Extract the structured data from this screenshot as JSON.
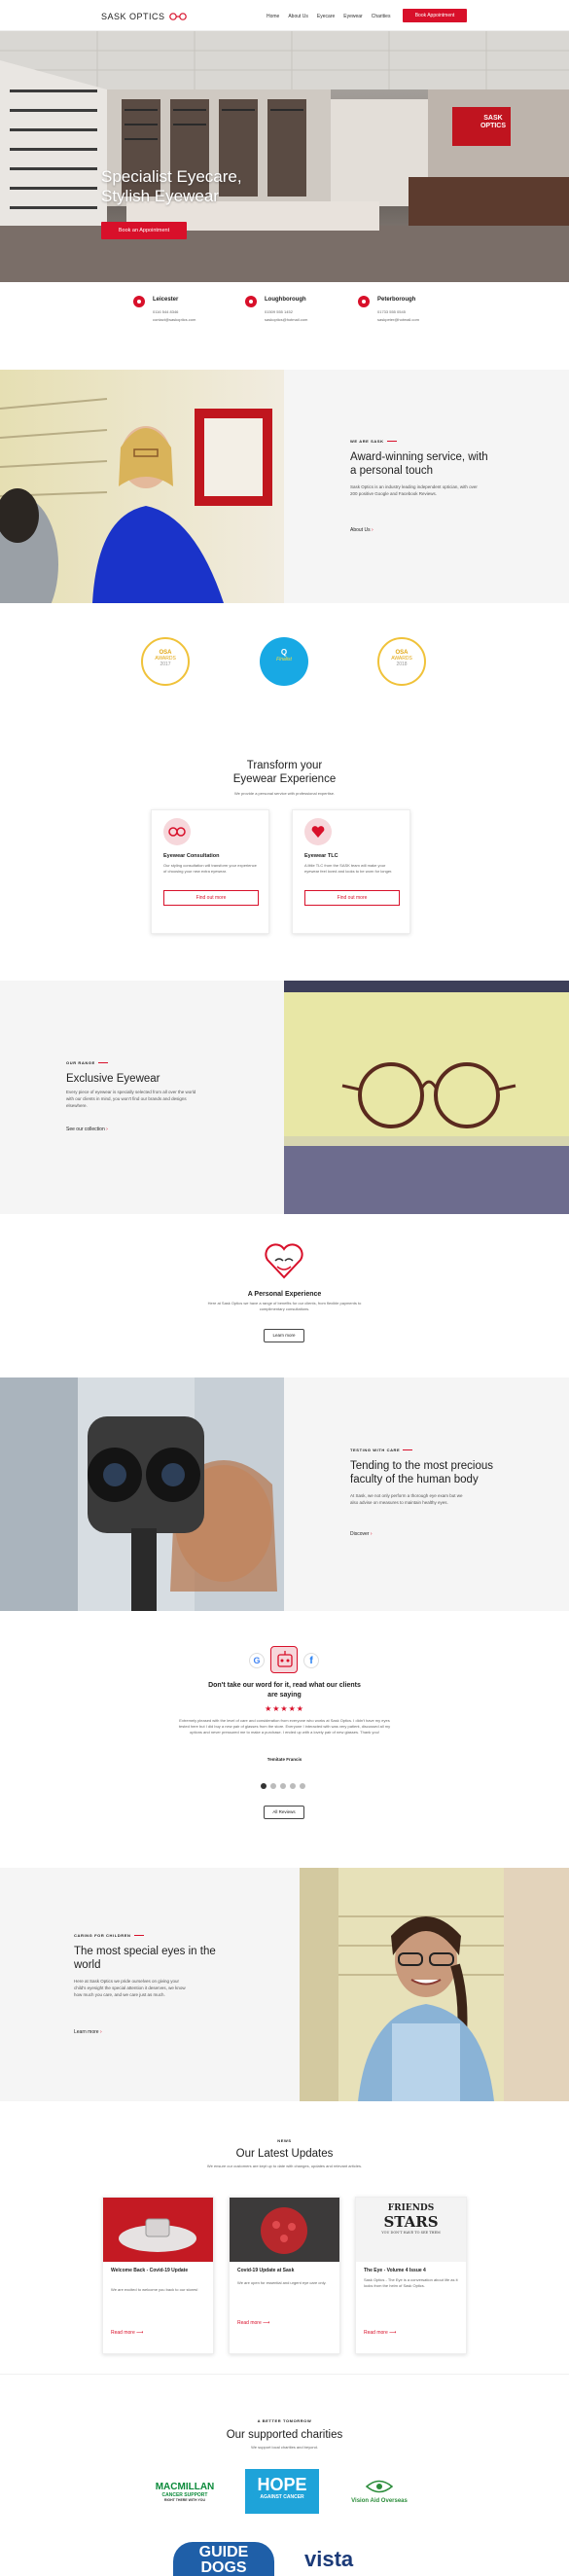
{
  "header": {
    "logo_text": "SASK OPTICS",
    "nav": [
      "Home",
      "About Us",
      "Eyecare",
      "Eyewear",
      "Charities"
    ],
    "cta": "Book Appointment"
  },
  "hero": {
    "title_line1": "Specialist Eyecare,",
    "title_line2": "Stylish Eyewear",
    "cta": "Book an Appointment",
    "sign_line1": "SASK",
    "sign_line2": "OPTICS"
  },
  "locations": [
    {
      "name": "Leicester",
      "phone": "0116 544 8346",
      "email": "contact@saskoptics.com"
    },
    {
      "name": "Loughborough",
      "phone": "01509 555 1452",
      "email": "saskoptics@hotmail.com"
    },
    {
      "name": "Peterborough",
      "phone": "01733 555 0545",
      "email": "saskpeter@hotmail.com"
    }
  ],
  "about": {
    "kicker": "WE ARE SASK",
    "title": "Award-winning service, with a personal touch",
    "body": "Sask Optics is an industry leading independent optician, with over 200 positive Google and Facebook Reviews.",
    "link": "About Us"
  },
  "awards": [
    {
      "line1": "OSA",
      "line2": "AWARDS",
      "line3": "2017"
    },
    {
      "line1": "Q",
      "line2": "Finalist",
      "line3": ""
    },
    {
      "line1": "OSA",
      "line2": "AWARDS",
      "line3": "2018"
    }
  ],
  "transform": {
    "title_line1": "Transform your",
    "title_line2": "Eyewear Experience",
    "subtitle": "We provide a personal service with professional expertise.",
    "cards": [
      {
        "title": "Eyewear Consultation",
        "body": "Our styling consultation will transform your experience of choosing your new extra eyewear.",
        "button": "Find out more"
      },
      {
        "title": "Eyewear TLC",
        "body": "A little TLC from the SASK team will make your eyewear feel loved and looks to be worn for longer.",
        "button": "Find out more"
      }
    ]
  },
  "range": {
    "kicker": "OUR RANGE",
    "title": "Exclusive Eyewear",
    "body": "Every piece of eyewear is specially selected from all over the world with our clients in mind, you won't find our brands and designs elsewhere.",
    "link": "See our collection"
  },
  "personal": {
    "title": "A Personal Experience",
    "body": "Here at Sask Optics we have a range of benefits for our clients, from flexible payments to complimentary consultations.",
    "button": "Learn more"
  },
  "testing": {
    "kicker": "TESTING WITH CARE",
    "title": "Tending to the most precious faculty of the human body",
    "body": "At Sask, we not only perform a thorough eye exam but we also advise on measures to maintain healthy eyes.",
    "link": "Discover"
  },
  "reviews": {
    "title_line1": "Don't take our word for it, read what our clients",
    "title_line2": "are saying",
    "stars": "★★★★★",
    "quote": "Extremely pleased with the level of care and consideration from everyone who works at Sask Optics. I didn't have my eyes tested here but I did buy a new pair of glasses from the store. Everyone I interacted with was very patient, discussed all my options and never pressured me to make a purchase. I ended up with a lovely pair of new glasses. Thank you!",
    "author": "Temitate Francis",
    "button": "All Reviews"
  },
  "children": {
    "kicker": "CARING FOR CHILDREN",
    "title": "The most special eyes in the world",
    "body": "Here at Sask Optics we pride ourselves on giving your child's eyesight the special attention it deserves, we know how much you care, and we care just as much.",
    "link": "Learn more"
  },
  "news": {
    "kicker": "NEWS",
    "title": "Our Latest Updates",
    "subtitle": "We ensure our customers are kept up to date with changes, updates and relevant articles.",
    "posts": [
      {
        "title": "Welcome Back - Covid-19 Update",
        "body": "We are excited to welcome you back to our stores!",
        "link": "Read more"
      },
      {
        "title": "Covid-19 Update at Sask",
        "body": "We are open for essential and urgent eye care only.",
        "link": "Read more"
      },
      {
        "title": "The Eye - Volume 4 Issue 4",
        "body": "Sask Optics - The Eye is a conversation about life as it looks from the helm of Sask Optics.",
        "link": "Read more"
      }
    ],
    "friends_line1": "FRIENDS",
    "friends_line2": "STARS",
    "friends_line3": "YOU DON'T HAVE TO SEE THEM"
  },
  "charities": {
    "kicker": "A BETTER TOMORROW",
    "title": "Our supported charities",
    "subtitle": "We support local charities and beyond.",
    "logos": [
      {
        "name_line1": "MACMILLAN",
        "name_line2": "CANCER SUPPORT",
        "name_line3": "RIGHT THERE WITH YOU"
      },
      {
        "name_line1": "HOPE",
        "name_line2": "AGAINST CANCER"
      },
      {
        "name_line1": "Vision Aid Overseas"
      },
      {
        "name_line1": "GUIDE",
        "name_line2": "DOGS"
      },
      {
        "name_line1": "vista"
      }
    ]
  },
  "colors": {
    "accent": "#d8102a",
    "dark": "#222222",
    "panel": "#f5f5f5"
  }
}
